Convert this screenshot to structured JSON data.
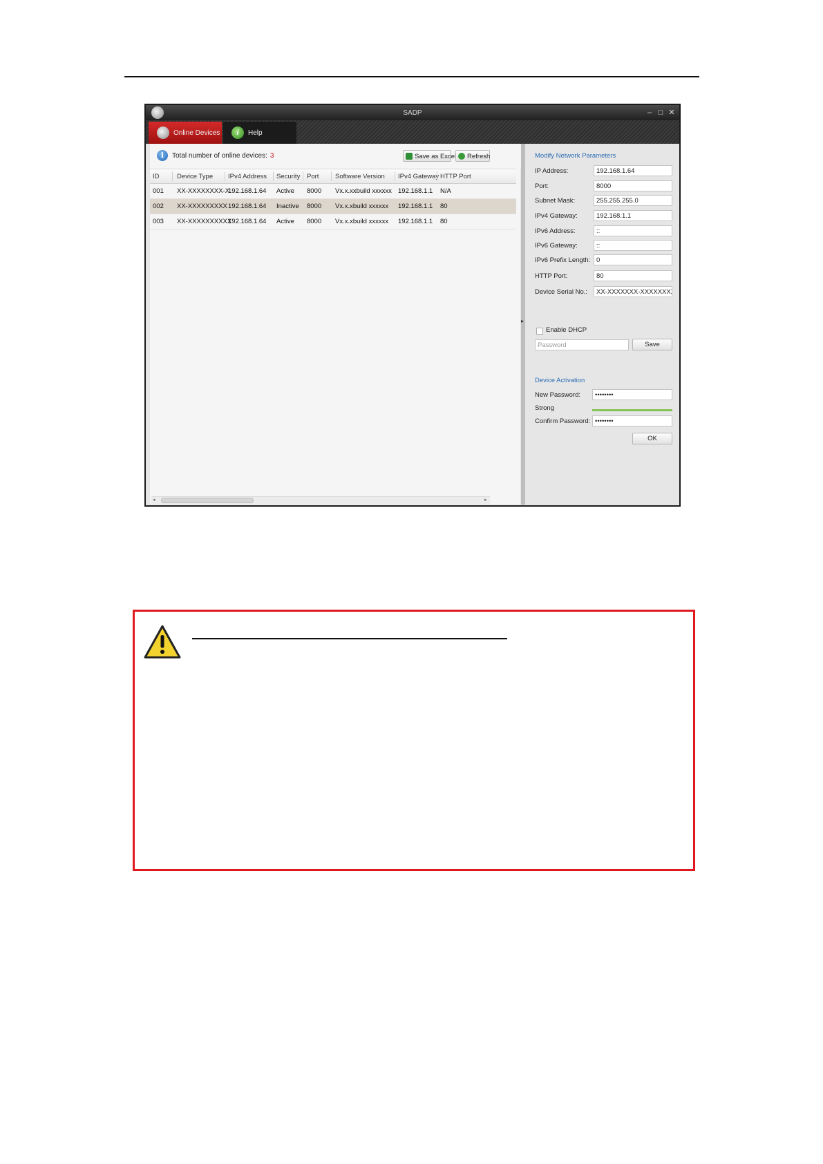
{
  "window": {
    "title": "SADP",
    "tabs": [
      {
        "label": "Online Devices",
        "icon": "search-icon"
      },
      {
        "label": "Help",
        "icon": "help-icon"
      }
    ]
  },
  "device_list": {
    "total_label": "Total number of online devices:",
    "total_count": "3",
    "buttons": {
      "save_excel": "Save as Excel",
      "refresh": "Refresh"
    },
    "columns": [
      "ID",
      "Device Type",
      "IPv4 Address",
      "Security",
      "Port",
      "Software Version",
      "IPv4 Gateway",
      "HTTP Port"
    ],
    "rows": [
      {
        "id": "001",
        "type": "XX-XXXXXXXX-X",
        "ip": "192.168.1.64",
        "security": "Active",
        "port": "8000",
        "software": "Vx.x.xxbuild xxxxxx",
        "gateway": "192.168.1.1",
        "http": "N/A"
      },
      {
        "id": "002",
        "type": "XX-XXXXXXXXX",
        "ip": "192.168.1.64",
        "security": "Inactive",
        "port": "8000",
        "software": "Vx.x.xbuild xxxxxx",
        "gateway": "192.168.1.1",
        "http": "80"
      },
      {
        "id": "003",
        "type": "XX-XXXXXXXXXX",
        "ip": "192.168.1.64",
        "security": "Active",
        "port": "8000",
        "software": "Vx.x.xbuild xxxxxx",
        "gateway": "192.168.1.1",
        "http": "80"
      }
    ],
    "selected_row": 1
  },
  "network_params": {
    "title": "Modify Network Parameters",
    "fields": [
      {
        "label": "IP Address:",
        "value": "192.168.1.64"
      },
      {
        "label": "Port:",
        "value": "8000"
      },
      {
        "label": "Subnet Mask:",
        "value": "255.255.255.0"
      },
      {
        "label": "IPv4 Gateway:",
        "value": "192.168.1.1"
      },
      {
        "label": "IPv6 Address:",
        "value": "::"
      },
      {
        "label": "IPv6 Gateway:",
        "value": "::"
      },
      {
        "label": "IPv6 Prefix Length:",
        "value": "0"
      },
      {
        "label": "HTTP Port:",
        "value": "80"
      },
      {
        "label": "Device Serial No.:",
        "value": "XX-XXXXXXX-XXXXXXXX"
      }
    ],
    "dhcp_label": "Enable DHCP",
    "dhcp_checked": false,
    "password_placeholder": "Password",
    "save_label": "Save"
  },
  "activation": {
    "title": "Device Activation",
    "new_password_label": "New Password:",
    "new_password_value": "••••••••",
    "strength_label": "Strong",
    "confirm_label": "Confirm Password:",
    "confirm_value": "••••••••",
    "ok_label": "OK"
  },
  "colors": {
    "accent_tab": "#c61b1b",
    "link_blue": "#2c6db5",
    "warning_border": "#e0191f",
    "strength": "#86c357"
  }
}
